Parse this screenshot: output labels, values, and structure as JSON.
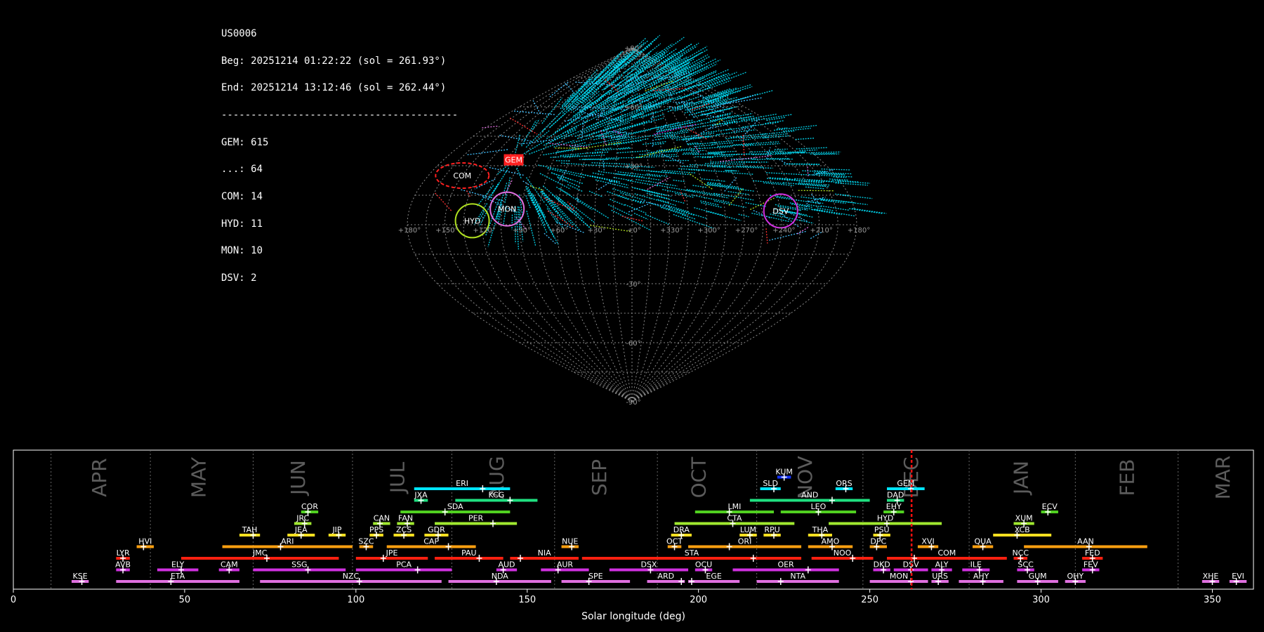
{
  "info": {
    "station": "US0006",
    "beg": "Beg: 20251214 01:22:22 (sol = 261.93°)",
    "end": "End: 20251214 13:12:46 (sol = 262.44°)",
    "separator": "----------------------------------------",
    "counts": [
      "GEM: 615",
      "...: 64",
      "COM: 14",
      "HYD: 11",
      "MON: 10",
      "DSV: 2"
    ]
  },
  "chart_data": [
    {
      "type": "scatter",
      "projection": "sinusoidal",
      "lon_tick_labels": [
        "+180°",
        "+150°",
        "+120°",
        "+90°",
        "+60°",
        "+30°",
        "+0°",
        "+330°",
        "+300°",
        "+270°",
        "+240°",
        "+210°",
        "+180°"
      ],
      "lat_tick_labels": [
        "+90°",
        "+60°",
        "+30°",
        "-30°",
        "-60°",
        "-90°"
      ],
      "grid": true,
      "radiants": [
        {
          "name": "GEM",
          "ra": 113,
          "dec": 33,
          "color": "#ff2020"
        },
        {
          "name": "COM",
          "ra": 150,
          "dec": 25,
          "color": "#ff2020"
        },
        {
          "name": "HYD",
          "ra": 128,
          "dec": 2,
          "color": "#b0e020"
        },
        {
          "name": "MON",
          "ra": 101,
          "dec": 8,
          "color": "#e070e0"
        },
        {
          "name": "DSV",
          "ra": 240,
          "dec": 7,
          "color": "#d030e0"
        }
      ],
      "series": [
        {
          "name": "GEM",
          "color": "#00e5ff",
          "count": 615
        },
        {
          "name": "...",
          "color": "#40c0ff",
          "count": 64
        },
        {
          "name": "COM",
          "color": "#ff3030",
          "count": 14
        },
        {
          "name": "HYD",
          "color": "#b0e020",
          "count": 11
        },
        {
          "name": "MON",
          "color": "#e070e0",
          "count": 10
        },
        {
          "name": "DSV",
          "color": "#d030e0",
          "count": 2
        }
      ]
    },
    {
      "type": "bar",
      "xlabel": "Solar longitude (deg)",
      "xlim": [
        0,
        362
      ],
      "xticks": [
        0,
        50,
        100,
        150,
        200,
        250,
        300,
        350
      ],
      "current_sol": 262.2,
      "months": [
        {
          "name": "APR",
          "sol": 25
        },
        {
          "name": "MAY",
          "sol": 54
        },
        {
          "name": "JUN",
          "sol": 83
        },
        {
          "name": "JUL",
          "sol": 112
        },
        {
          "name": "AUG",
          "sol": 141
        },
        {
          "name": "SEP",
          "sol": 171
        },
        {
          "name": "OCT",
          "sol": 200
        },
        {
          "name": "NOV",
          "sol": 231
        },
        {
          "name": "DEC",
          "sol": 262
        },
        {
          "name": "JAN",
          "sol": 294
        },
        {
          "name": "FEB",
          "sol": 325
        },
        {
          "name": "MAR",
          "sol": 353
        }
      ],
      "month_dividers": [
        11,
        40,
        70,
        99,
        128,
        158,
        188,
        217,
        248,
        279,
        310,
        340
      ],
      "showers": [
        {
          "code": "KUM",
          "start": 223,
          "end": 227,
          "peak": 225,
          "row": 10,
          "color": "#1030ff"
        },
        {
          "code": "ERI",
          "start": 117,
          "end": 145,
          "peak": 137,
          "row": 9,
          "color": "#00e5ff"
        },
        {
          "code": "SLD",
          "start": 218,
          "end": 224,
          "peak": 222,
          "row": 9,
          "color": "#00e5ff"
        },
        {
          "code": "ORS",
          "start": 240,
          "end": 245,
          "peak": 243,
          "row": 9,
          "color": "#00e5ff"
        },
        {
          "code": "GEM",
          "start": 255,
          "end": 266,
          "peak": 262,
          "row": 9,
          "color": "#00e5ff"
        },
        {
          "code": "JXA",
          "start": 117,
          "end": 121,
          "peak": 119,
          "row": 8,
          "color": "#20e080"
        },
        {
          "code": "KCG",
          "start": 129,
          "end": 153,
          "peak": 145,
          "row": 8,
          "color": "#20e080"
        },
        {
          "code": "AND",
          "start": 215,
          "end": 250,
          "peak": 239,
          "row": 8,
          "color": "#20e080"
        },
        {
          "code": "DAD",
          "start": 255,
          "end": 260,
          "peak": 258,
          "row": 8,
          "color": "#20e080"
        },
        {
          "code": "COR",
          "start": 84,
          "end": 89,
          "peak": 86,
          "row": 7,
          "color": "#50d020"
        },
        {
          "code": "SDA",
          "start": 113,
          "end": 145,
          "peak": 126,
          "row": 7,
          "color": "#50d020"
        },
        {
          "code": "LMI",
          "start": 199,
          "end": 222,
          "peak": 209,
          "row": 7,
          "color": "#50d020"
        },
        {
          "code": "LEO",
          "start": 224,
          "end": 246,
          "peak": 235,
          "row": 7,
          "color": "#50d020"
        },
        {
          "code": "EHY",
          "start": 254,
          "end": 260,
          "peak": 257,
          "row": 7,
          "color": "#50d020"
        },
        {
          "code": "ECV",
          "start": 300,
          "end": 305,
          "peak": 302,
          "row": 7,
          "color": "#50d020"
        },
        {
          "code": "JRC",
          "start": 82,
          "end": 87,
          "peak": 85,
          "row": 6,
          "color": "#a0e830"
        },
        {
          "code": "CAN",
          "start": 105,
          "end": 110,
          "peak": 107,
          "row": 6,
          "color": "#a0e830"
        },
        {
          "code": "FAN",
          "start": 112,
          "end": 117,
          "peak": 115,
          "row": 6,
          "color": "#a0e830"
        },
        {
          "code": "PER",
          "start": 123,
          "end": 147,
          "peak": 140,
          "row": 6,
          "color": "#a0e830"
        },
        {
          "code": "CTA",
          "start": 193,
          "end": 228,
          "peak": 210,
          "row": 6,
          "color": "#a0e830"
        },
        {
          "code": "HYD",
          "start": 238,
          "end": 271,
          "peak": 255,
          "row": 6,
          "color": "#a0e830"
        },
        {
          "code": "XUM",
          "start": 292,
          "end": 298,
          "peak": 295,
          "row": 6,
          "color": "#a0e830"
        },
        {
          "code": "TAH",
          "start": 66,
          "end": 72,
          "peak": 70,
          "row": 5,
          "color": "#ffe020"
        },
        {
          "code": "JEA",
          "start": 80,
          "end": 88,
          "peak": 84,
          "row": 5,
          "color": "#ffe020"
        },
        {
          "code": "JIP",
          "start": 92,
          "end": 97,
          "peak": 95,
          "row": 5,
          "color": "#ffe020"
        },
        {
          "code": "PPS",
          "start": 104,
          "end": 108,
          "peak": 106,
          "row": 5,
          "color": "#ffe020"
        },
        {
          "code": "ZCS",
          "start": 111,
          "end": 117,
          "peak": 114,
          "row": 5,
          "color": "#ffe020"
        },
        {
          "code": "GDR",
          "start": 120,
          "end": 127,
          "peak": 124,
          "row": 5,
          "color": "#ffe020"
        },
        {
          "code": "DRA",
          "start": 192,
          "end": 198,
          "peak": 195,
          "row": 5,
          "color": "#ffe020"
        },
        {
          "code": "LUM",
          "start": 212,
          "end": 217,
          "peak": 215,
          "row": 5,
          "color": "#ffe020"
        },
        {
          "code": "RPU",
          "start": 219,
          "end": 224,
          "peak": 222,
          "row": 5,
          "color": "#ffe020"
        },
        {
          "code": "THA",
          "start": 232,
          "end": 239,
          "peak": 236,
          "row": 5,
          "color": "#ffe020"
        },
        {
          "code": "PSU",
          "start": 251,
          "end": 256,
          "peak": 253,
          "row": 5,
          "color": "#ffe020"
        },
        {
          "code": "XCB",
          "start": 286,
          "end": 303,
          "peak": 293,
          "row": 5,
          "color": "#ffe020"
        },
        {
          "code": "HVI",
          "start": 36,
          "end": 41,
          "peak": 38,
          "row": 4,
          "color": "#ffa010"
        },
        {
          "code": "ARI",
          "start": 61,
          "end": 99,
          "peak": 78,
          "row": 4,
          "color": "#ffa010"
        },
        {
          "code": "SZC",
          "start": 101,
          "end": 105,
          "peak": 103,
          "row": 4,
          "color": "#ffa010"
        },
        {
          "code": "CAP",
          "start": 109,
          "end": 135,
          "peak": 127,
          "row": 4,
          "color": "#ffa010"
        },
        {
          "code": "NUE",
          "start": 160,
          "end": 165,
          "peak": 163,
          "row": 4,
          "color": "#ffa010"
        },
        {
          "code": "OCT",
          "start": 191,
          "end": 195,
          "peak": 193,
          "row": 4,
          "color": "#ffa010"
        },
        {
          "code": "ORI",
          "start": 197,
          "end": 230,
          "peak": 209,
          "row": 4,
          "color": "#ffa010"
        },
        {
          "code": "AMO",
          "start": 232,
          "end": 245,
          "peak": 239,
          "row": 4,
          "color": "#ffa010"
        },
        {
          "code": "DPC",
          "start": 250,
          "end": 255,
          "peak": 252,
          "row": 4,
          "color": "#ffa010"
        },
        {
          "code": "XVI",
          "start": 264,
          "end": 270,
          "peak": 268,
          "row": 4,
          "color": "#ffa010"
        },
        {
          "code": "QUA",
          "start": 280,
          "end": 286,
          "peak": 283,
          "row": 4,
          "color": "#ffa010"
        },
        {
          "code": "AAN",
          "start": 295,
          "end": 331,
          "peak": 314,
          "row": 4,
          "color": "#ffa010"
        },
        {
          "code": "LYR",
          "start": 30,
          "end": 34,
          "peak": 32,
          "row": 3,
          "color": "#ff2010"
        },
        {
          "code": "JMC",
          "start": 49,
          "end": 95,
          "peak": 74,
          "row": 3,
          "color": "#ff2010"
        },
        {
          "code": "JPE",
          "start": 100,
          "end": 121,
          "peak": 108,
          "row": 3,
          "color": "#ff2010"
        },
        {
          "code": "PAU",
          "start": 123,
          "end": 143,
          "peak": 136,
          "row": 3,
          "color": "#ff2010"
        },
        {
          "code": "NIA",
          "start": 145,
          "end": 165,
          "peak": 148,
          "row": 3,
          "color": "#ff2010"
        },
        {
          "code": "STA",
          "start": 166,
          "end": 230,
          "peak": 216,
          "row": 3,
          "color": "#ff2010"
        },
        {
          "code": "NOO",
          "start": 233,
          "end": 251,
          "peak": 245,
          "row": 3,
          "color": "#ff2010"
        },
        {
          "code": "COM",
          "start": 255,
          "end": 290,
          "peak": 263,
          "row": 3,
          "color": "#ff2010"
        },
        {
          "code": "NCC",
          "start": 292,
          "end": 296,
          "peak": 294,
          "row": 3,
          "color": "#ff2010"
        },
        {
          "code": "FED",
          "start": 312,
          "end": 318,
          "peak": 315,
          "row": 3,
          "color": "#ff2010"
        },
        {
          "code": "AVB",
          "start": 30,
          "end": 34,
          "peak": 32,
          "row": 2,
          "color": "#d030e0"
        },
        {
          "code": "ELY",
          "start": 42,
          "end": 54,
          "peak": 49,
          "row": 2,
          "color": "#d030e0"
        },
        {
          "code": "CAM",
          "start": 60,
          "end": 66,
          "peak": 63,
          "row": 2,
          "color": "#d030e0"
        },
        {
          "code": "SSG",
          "start": 70,
          "end": 97,
          "peak": 86,
          "row": 2,
          "color": "#d030e0"
        },
        {
          "code": "PCA",
          "start": 100,
          "end": 128,
          "peak": 118,
          "row": 2,
          "color": "#d030e0"
        },
        {
          "code": "AUD",
          "start": 141,
          "end": 147,
          "peak": 143,
          "row": 2,
          "color": "#d030e0"
        },
        {
          "code": "AUR",
          "start": 154,
          "end": 168,
          "peak": 159,
          "row": 2,
          "color": "#d030e0"
        },
        {
          "code": "DSX",
          "start": 174,
          "end": 197,
          "peak": 186,
          "row": 2,
          "color": "#d030e0"
        },
        {
          "code": "OCU",
          "start": 199,
          "end": 204,
          "peak": 202,
          "row": 2,
          "color": "#d030e0"
        },
        {
          "code": "OER",
          "start": 210,
          "end": 241,
          "peak": 232,
          "row": 2,
          "color": "#d030e0"
        },
        {
          "code": "DKD",
          "start": 251,
          "end": 256,
          "peak": 254,
          "row": 2,
          "color": "#d030e0"
        },
        {
          "code": "DSV",
          "start": 257,
          "end": 267,
          "peak": 262,
          "row": 2,
          "color": "#d030e0"
        },
        {
          "code": "ALY",
          "start": 268,
          "end": 274,
          "peak": 271,
          "row": 2,
          "color": "#d030e0"
        },
        {
          "code": "ILE",
          "start": 277,
          "end": 285,
          "peak": 282,
          "row": 2,
          "color": "#d030e0"
        },
        {
          "code": "SCC",
          "start": 293,
          "end": 298,
          "peak": 296,
          "row": 2,
          "color": "#d030e0"
        },
        {
          "code": "FEV",
          "start": 312,
          "end": 317,
          "peak": 315,
          "row": 2,
          "color": "#d030e0"
        },
        {
          "code": "KSE",
          "start": 17,
          "end": 22,
          "peak": 20,
          "row": 1,
          "color": "#e070e0"
        },
        {
          "code": "ETA",
          "start": 30,
          "end": 66,
          "peak": 46,
          "row": 1,
          "color": "#e070e0"
        },
        {
          "code": "NZC",
          "start": 72,
          "end": 125,
          "peak": 101,
          "row": 1,
          "color": "#e070e0"
        },
        {
          "code": "NDA",
          "start": 127,
          "end": 157,
          "peak": 141,
          "row": 1,
          "color": "#e070e0"
        },
        {
          "code": "SPE",
          "start": 160,
          "end": 180,
          "peak": 168,
          "row": 1,
          "color": "#e070e0"
        },
        {
          "code": "ARD",
          "start": 185,
          "end": 196,
          "peak": 195,
          "row": 1,
          "color": "#e070e0"
        },
        {
          "code": "EGE",
          "start": 197,
          "end": 212,
          "peak": 198,
          "row": 1,
          "color": "#e070e0"
        },
        {
          "code": "NTA",
          "start": 217,
          "end": 241,
          "peak": 224,
          "row": 1,
          "color": "#e070e0"
        },
        {
          "code": "MON",
          "start": 250,
          "end": 267,
          "peak": 262,
          "row": 1,
          "color": "#e070e0"
        },
        {
          "code": "URS",
          "start": 268,
          "end": 273,
          "peak": 270,
          "row": 1,
          "color": "#e070e0"
        },
        {
          "code": "AHY",
          "start": 276,
          "end": 289,
          "peak": 283,
          "row": 1,
          "color": "#e070e0"
        },
        {
          "code": "GUM",
          "start": 293,
          "end": 305,
          "peak": 299,
          "row": 1,
          "color": "#e070e0"
        },
        {
          "code": "OHY",
          "start": 307,
          "end": 313,
          "peak": 310,
          "row": 1,
          "color": "#e070e0"
        },
        {
          "code": "XHE",
          "start": 347,
          "end": 352,
          "peak": 350,
          "row": 1,
          "color": "#e070e0"
        },
        {
          "code": "EVI",
          "start": 355,
          "end": 360,
          "peak": 357,
          "row": 1,
          "color": "#e070e0"
        }
      ]
    }
  ]
}
